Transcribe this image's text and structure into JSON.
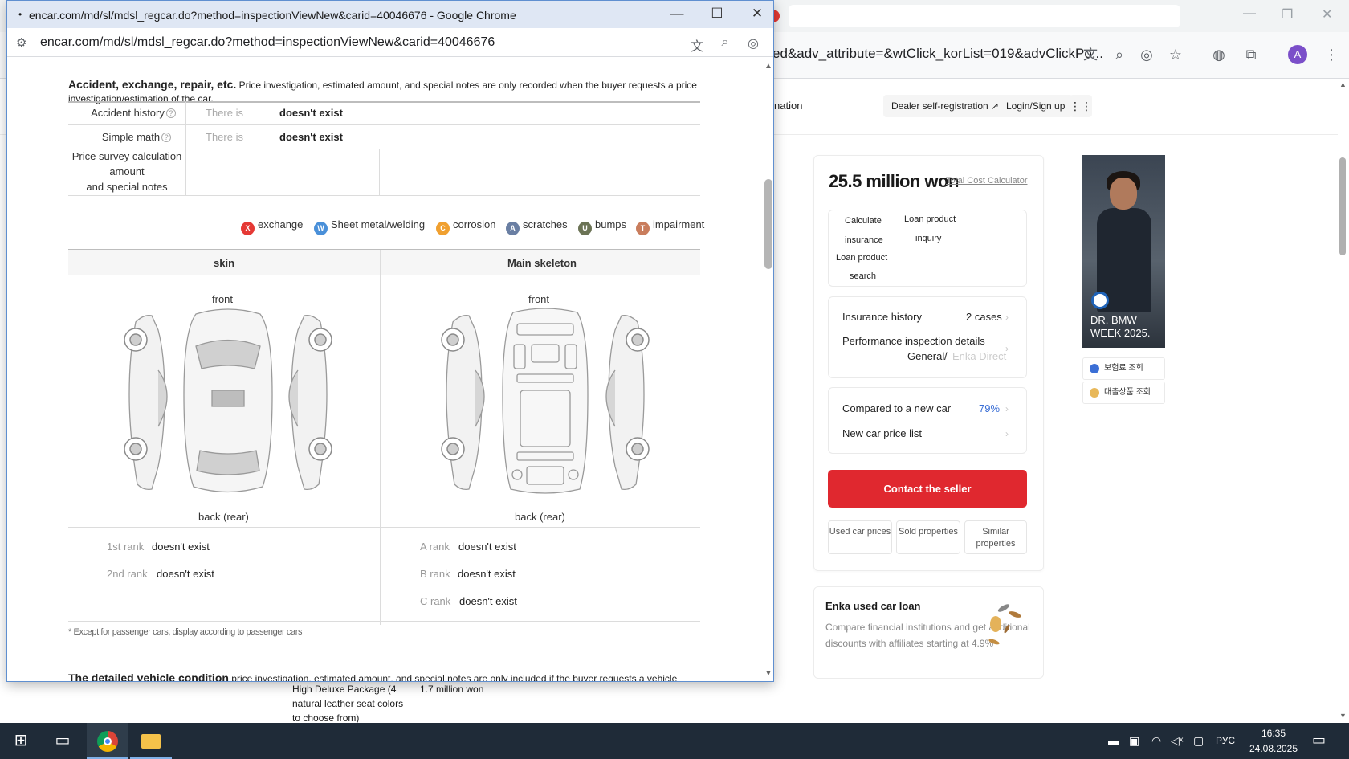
{
  "background_window": {
    "url_fragment": "ed&adv_attribute=&wtClick_korList=019&advClickPo...",
    "header": {
      "nav_partial": "nation",
      "dealer_btn": "Dealer self-registration ↗",
      "login_btn": "Login/Sign up",
      "grid_icon": "⋮⋮"
    },
    "price": {
      "amount": "25.5 million won",
      "calc_link": "Total Cost Calculator",
      "mini": {
        "calc": "Calculate",
        "insurance": "insurance",
        "loan_overlap": "Loan product",
        "search": "search",
        "loan_product": "Loan product",
        "inquiry": "inquiry"
      },
      "insurance_history_label": "Insurance history",
      "insurance_history_value": "2 cases",
      "perf_label": "Performance inspection details",
      "perf_general": "General",
      "perf_sep": "/",
      "perf_direct": "Enka Direct",
      "compared_label": "Compared to a new car",
      "compared_value": "79%",
      "newcar_label": "New car price list",
      "contact": "Contact the seller",
      "btn_used": "Used car prices",
      "btn_sold": "Sold properties",
      "btn_similar": "Similar properties"
    },
    "loan": {
      "title": "Enka used car loan",
      "desc": "Compare financial institutions and get additional discounts with affiliates starting at 4.9%~"
    },
    "ad": {
      "text_line1": "DR. BMW",
      "text_line2": "WEEK 2025.",
      "link1": "보험료 조회",
      "link2": "대출상품 조회"
    },
    "under_popup": {
      "package_text": "High Deluxe Package (4 natural leather seat colors to choose from)",
      "package_price": "1.7 million won"
    }
  },
  "popup": {
    "title": "encar.com/md/sl/mdsl_regcar.do?method=inspectionViewNew&carid=40046676 - Google Chrome",
    "url": "encar.com/md/sl/mdsl_regcar.do?method=inspectionViewNew&carid=40046676",
    "section": {
      "title": "Accident, exchange, repair, etc.",
      "note": "Price investigation, estimated amount, and special notes are only recorded when the buyer requests a price investigation/estimation of the car."
    },
    "table": {
      "row1_label": "Accident history",
      "row1_gray": "There is",
      "row1_value": "doesn't exist",
      "row2_label": "Simple math",
      "row2_gray": "There is",
      "row2_value": "doesn't exist",
      "row3_label_1": "Price survey calculation",
      "row3_label_2": "amount",
      "row3_label_3": "and special notes"
    },
    "legend": [
      {
        "code": "X",
        "label": "exchange",
        "color": "#e53935"
      },
      {
        "code": "W",
        "label": "Sheet metal/welding",
        "color": "#4a90d9"
      },
      {
        "code": "C",
        "label": "corrosion",
        "color": "#f0a030"
      },
      {
        "code": "A",
        "label": "scratches",
        "color": "#6a7fa3"
      },
      {
        "code": "U",
        "label": "bumps",
        "color": "#6b7355"
      },
      {
        "code": "T",
        "label": "impairment",
        "color": "#c97d5d"
      }
    ],
    "diagram": {
      "col1": "skin",
      "col2": "Main skeleton",
      "front": "front",
      "back": "back (rear)"
    },
    "ranks_left": [
      {
        "rank": "1st rank",
        "value": "doesn't exist"
      },
      {
        "rank": "2nd rank",
        "value": "doesn't exist"
      }
    ],
    "ranks_right": [
      {
        "rank": "A rank",
        "value": "doesn't exist"
      },
      {
        "rank": "B rank",
        "value": "doesn't exist"
      },
      {
        "rank": "C rank",
        "value": "doesn't exist"
      }
    ],
    "footnote": "* Except for passenger cars, display according to passenger cars",
    "next_section_title": "The detailed vehicle condition",
    "next_section_note": "price investigation, estimated amount, and special notes are only included if the buyer requests a vehicle"
  },
  "taskbar": {
    "lang": "РУС",
    "time": "16:35",
    "date": "24.08.2025"
  }
}
